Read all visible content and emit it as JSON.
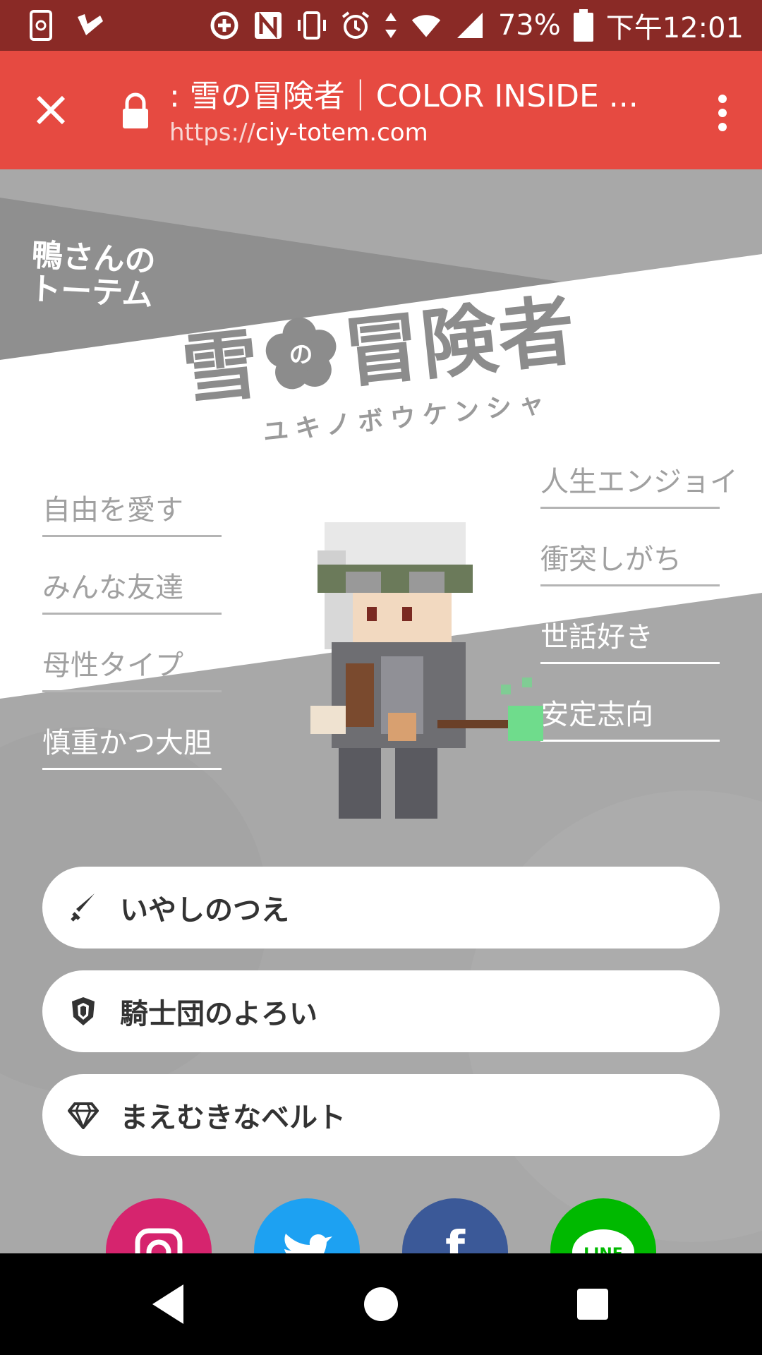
{
  "status_bar": {
    "battery": "73%",
    "time": "下午12:01",
    "icons": [
      "screenshot-icon",
      "check-icon",
      "data-saver-icon",
      "nfc-icon",
      "vibrate-icon",
      "alarm-icon",
      "data-arrows-icon",
      "wifi-icon",
      "signal-icon",
      "battery-icon"
    ]
  },
  "browser": {
    "title": ": 雪の冒険者｜COLOR INSIDE ...",
    "url_scheme": "https://",
    "url_domain": "ciy-totem.com",
    "icons": [
      "close-icon",
      "lock-icon",
      "more-vert-icon"
    ]
  },
  "page": {
    "owner_label_line1": "鴨さんの",
    "owner_label_line2": "トーテム",
    "title_part1": "雪",
    "title_flower_text": "の",
    "title_part2": "冒険者",
    "subtitle": "ユキノボウケンシャ",
    "traits_left": [
      "自由を愛す",
      "みんな友達",
      "母性タイプ",
      "慎重かつ大胆"
    ],
    "traits_right": [
      "人生エンジョイ",
      "衝突しがち",
      "世話好き",
      "安定志向"
    ],
    "items": [
      {
        "label": "いやしのつえ",
        "icon": "sword-icon"
      },
      {
        "label": "騎士団のよろい",
        "icon": "shield-icon"
      },
      {
        "label": "まえむきなベルト",
        "icon": "diamond-icon"
      }
    ],
    "social": [
      {
        "name": "instagram",
        "color": "#d6246e"
      },
      {
        "name": "twitter",
        "color": "#1da1f2"
      },
      {
        "name": "facebook",
        "color": "#3b5998"
      },
      {
        "name": "line",
        "color": "#00b900",
        "text": "LINE"
      }
    ]
  },
  "colors": {
    "status_bar": "#8a2a26",
    "toolbar": "#e64a41",
    "page_bg": "#a8a8a8"
  }
}
